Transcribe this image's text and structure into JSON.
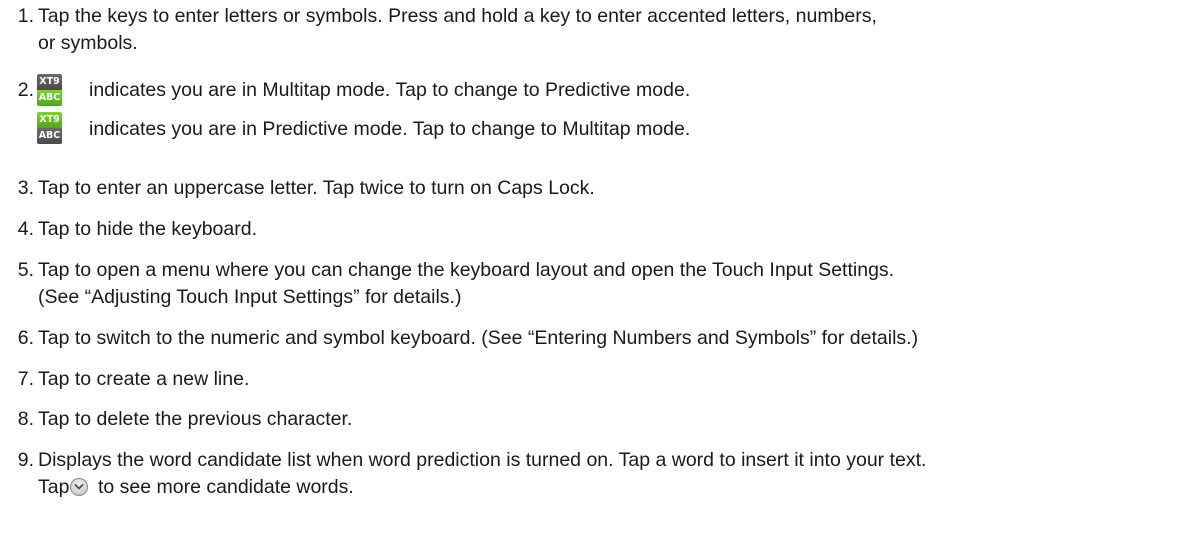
{
  "items": [
    {
      "number": "1.",
      "line1": "Tap the keys to enter letters or symbols. Press and hold a key to enter accented letters, numbers,",
      "line2": "or symbols."
    },
    {
      "number": "2.",
      "line1": "indicates you are in Multitap mode. Tap to change to Predictive mode.",
      "icon": "xt9-abc-multitap-icon"
    },
    {
      "number": "",
      "line1": "indicates you are in Predictive mode. Tap to change to Multitap mode.",
      "icon": "xt9-abc-predictive-icon"
    },
    {
      "number": "3.",
      "line1": "Tap to enter an uppercase letter. Tap twice to turn on Caps Lock."
    },
    {
      "number": "4.",
      "line1": "Tap to hide the keyboard."
    },
    {
      "number": "5.",
      "line1": "Tap to open a menu where you can change the keyboard layout and open the Touch Input Settings.",
      "line2": "(See “Adjusting Touch Input Settings” for details.)"
    },
    {
      "number": "6.",
      "line1": "Tap to switch to the numeric and symbol keyboard. (See “Entering Numbers and Symbols” for details.)"
    },
    {
      "number": "7.",
      "line1": "Tap to create a new line."
    },
    {
      "number": "8.",
      "line1": "Tap to delete the previous character."
    },
    {
      "number": "9.",
      "line1": "Displays the word candidate list when word prediction is turned on. Tap a word to insert it into your text.",
      "line2_before": "Tap",
      "line2_after": "to see more candidate words.",
      "icon": "expand-more-icon"
    }
  ],
  "icons": {
    "xt9_label": "XT9",
    "abc_label": "ABC",
    "green": "#5cb81c",
    "grey": "#555555"
  }
}
